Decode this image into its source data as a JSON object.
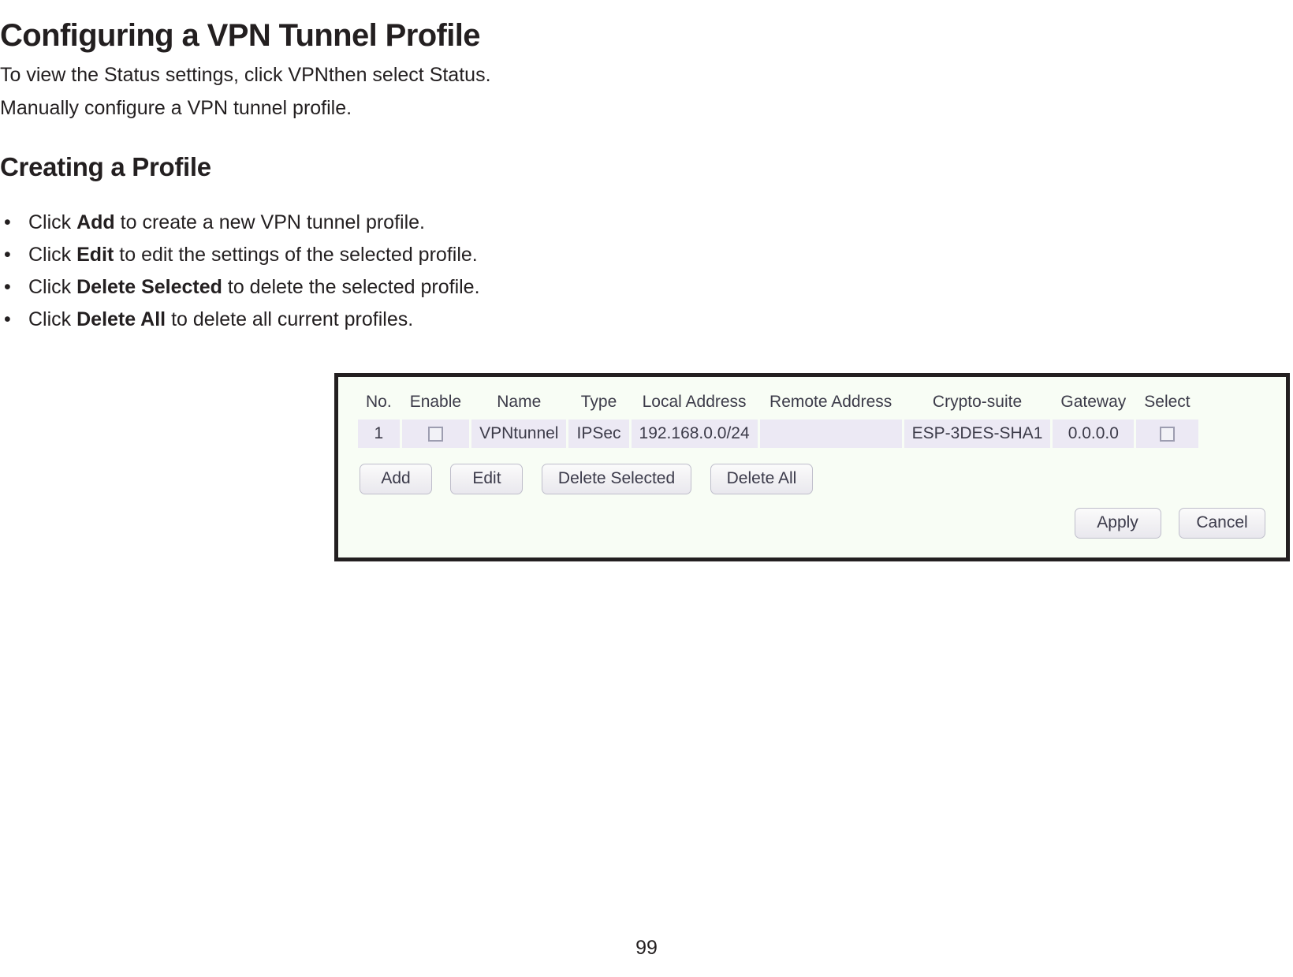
{
  "document": {
    "title": "Configuring a VPN Tunnel Profile",
    "intro_line_1": "To view the Status settings, click VPNthen select Status.",
    "intro_line_2": "Manually configure a VPN tunnel profile.",
    "section_heading": "Creating a Profile",
    "page_number": "99",
    "bullet_marker": "•",
    "bullets": [
      {
        "prefix": "Click ",
        "bold": "Add",
        "suffix": " to create a new VPN tunnel profile."
      },
      {
        "prefix": "Click ",
        "bold": "Edit",
        "suffix": " to edit the settings of the selected profile."
      },
      {
        "prefix": "Click ",
        "bold": "Delete Selected",
        "suffix": " to delete the selected profile."
      },
      {
        "prefix": "Click ",
        "bold": "Delete All",
        "suffix": " to delete all current profiles."
      }
    ]
  },
  "ui_panel": {
    "table": {
      "headers": [
        "No.",
        "Enable",
        "Name",
        "Type",
        "Local Address",
        "Remote Address",
        "Crypto-suite",
        "Gateway",
        "Select"
      ],
      "rows": [
        {
          "no": "1",
          "enable_checked": false,
          "name": "VPNtunnel",
          "type": "IPSec",
          "local_address": "192.168.0.0/24",
          "remote_address": "",
          "crypto_suite": "ESP-3DES-SHA1",
          "gateway": "0.0.0.0",
          "select_checked": false
        }
      ]
    },
    "action_buttons": [
      "Add",
      "Edit",
      "Delete Selected",
      "Delete All"
    ],
    "footer_buttons": [
      "Apply",
      "Cancel"
    ]
  },
  "colors": {
    "panel_border": "#231f20",
    "panel_background": "#f8fdf5",
    "table_cell_background": "#ece9f4",
    "text": "#3c3b49",
    "document_text": "#231f20"
  }
}
